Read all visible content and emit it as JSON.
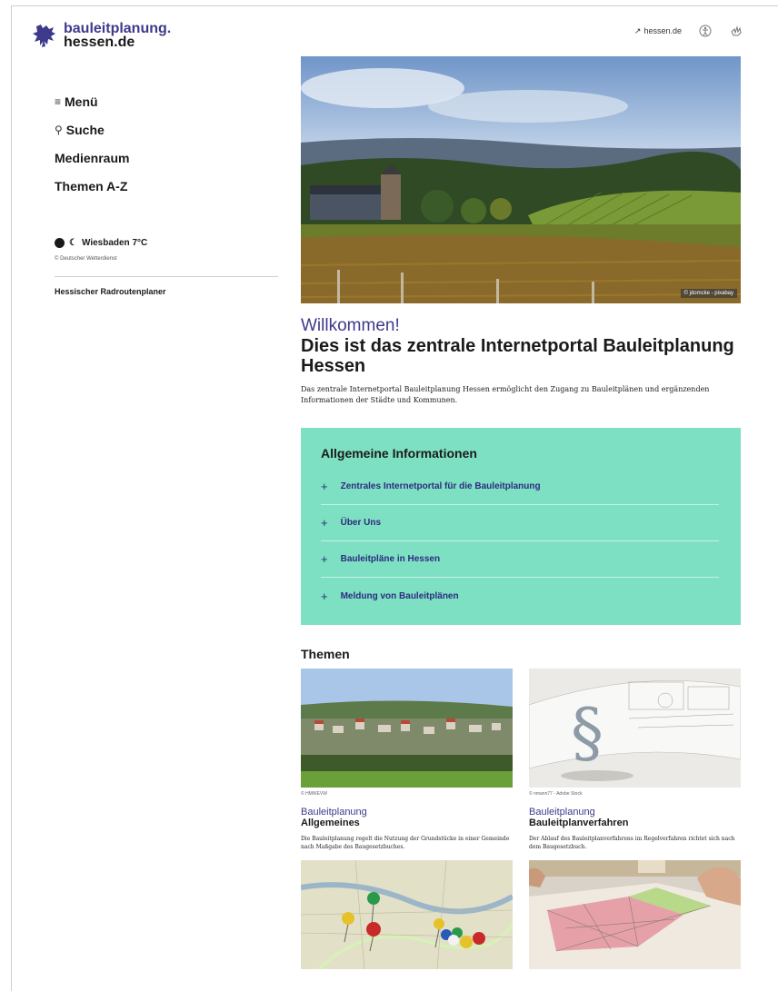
{
  "header": {
    "logo_line1": "bauleitplanung.",
    "logo_line2": "hessen.de",
    "ext_link": "hessen.de",
    "ext_arrow": "↗",
    "icons": [
      "accessibility-icon",
      "sign-language-icon"
    ]
  },
  "sidebar": {
    "items": [
      {
        "icon": "≡",
        "label": "Menü"
      },
      {
        "icon": "⚲",
        "label": "Suche"
      },
      {
        "icon": "",
        "label": "Medienraum"
      },
      {
        "icon": "",
        "label": "Themen A-Z"
      }
    ],
    "weather": "Wiesbaden 7°C",
    "weather_source": "© Deutscher Wetterdienst",
    "link_radroutenplaner": "Hessischer Radroutenplaner"
  },
  "hero": {
    "credit": "© jdomcke - pixabay"
  },
  "main": {
    "welcome": "Willkommen!",
    "headline": "Dies ist das zentrale Internetportal Bauleitplanung Hessen",
    "intro": "Das zentrale Internetportal Bauleitplanung Hessen ermöglicht den Zugang zu Bauleitplänen und ergänzenden Informationen der Städte und Kommunen."
  },
  "info": {
    "title": "Allgemeine Informationen",
    "items": [
      "Zentrales Internetportal für die Bauleitplanung",
      "Über Uns",
      "Bauleitpläne in Hessen",
      "Meldung von Bauleitplänen"
    ]
  },
  "themen": {
    "title": "Themen",
    "cards": [
      {
        "credit": "© HMWEVW",
        "category": "Bauleitplanung",
        "title": "Allgemeines",
        "desc": "Die Bauleitplanung regelt die Nutzung der Grundstücke in einer Gemeinde nach Maßgabe des Baugesetzbuches."
      },
      {
        "credit": "© nmann77 - Adobe Stock",
        "category": "Bauleitplanung",
        "title": "Bauleitplanverfahren",
        "desc": "Der Ablauf des Bauleitplanverfahrens im Regelverfahren richtet sich nach dem Baugesetzbuch."
      },
      {
        "credit": "",
        "category": "",
        "title": "",
        "desc": ""
      },
      {
        "credit": "",
        "category": "",
        "title": "",
        "desc": ""
      }
    ]
  },
  "colors": {
    "brand": "#3d3a8c",
    "info_box": "#7ee0c2"
  }
}
